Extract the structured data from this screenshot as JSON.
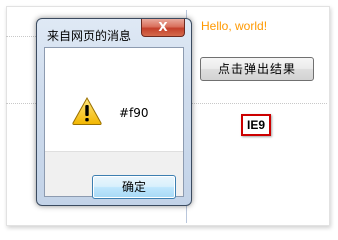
{
  "page": {
    "hello_text": "Hello, world!",
    "popup_button_label": "点击弹出结果",
    "ie_badge": "IE9"
  },
  "dialog": {
    "title": "来自网页的消息",
    "close_label": "X",
    "message": "#f90",
    "ok_label": "确定",
    "icon": "warning-icon"
  },
  "colors": {
    "hello_text": "#ff9900",
    "badge_border": "#cc0000",
    "close_button": "#c4402b"
  }
}
